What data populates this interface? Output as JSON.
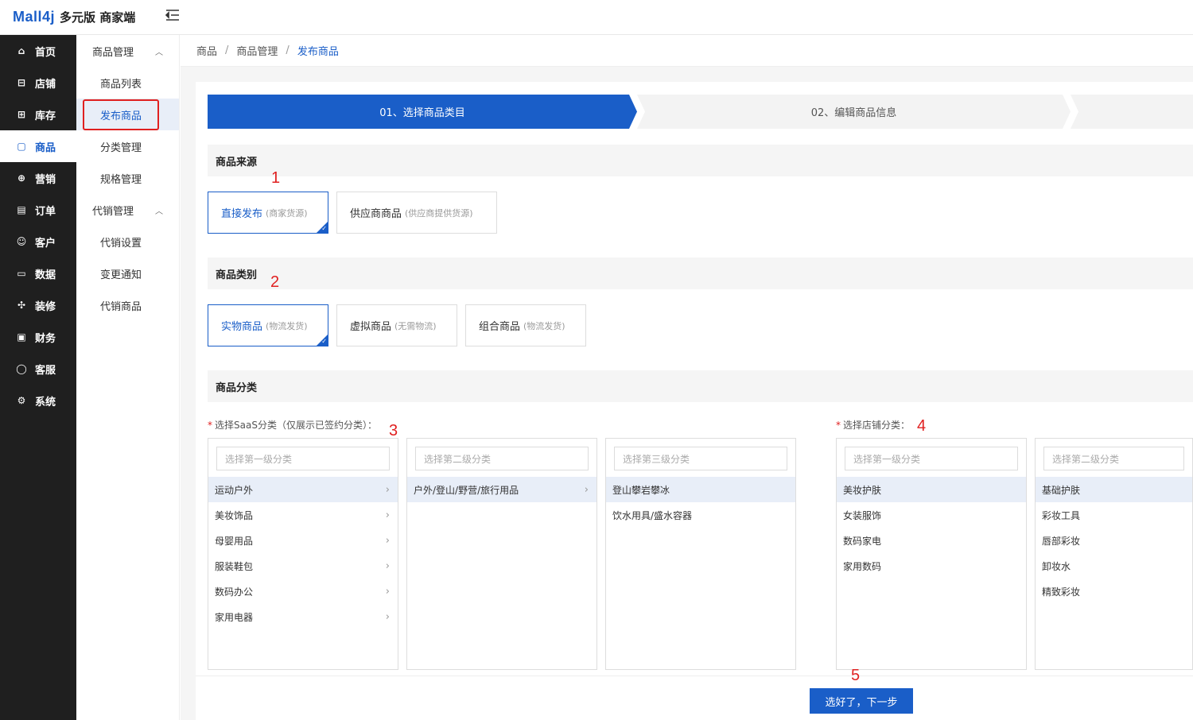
{
  "header": {
    "brand": "Mall4j",
    "subtitle": "多元版 商家端"
  },
  "leftnav": [
    {
      "label": "首页",
      "icon": "home-icon",
      "glyph": "⌂"
    },
    {
      "label": "店铺",
      "icon": "shop-icon",
      "glyph": "⊟"
    },
    {
      "label": "库存",
      "icon": "stock-icon",
      "glyph": "⊞"
    },
    {
      "label": "商品",
      "icon": "goods-icon",
      "glyph": "▢"
    },
    {
      "label": "营销",
      "icon": "gift-icon",
      "glyph": "⊕"
    },
    {
      "label": "订单",
      "icon": "order-icon",
      "glyph": "▤"
    },
    {
      "label": "客户",
      "icon": "customer-icon",
      "glyph": "☺"
    },
    {
      "label": "数据",
      "icon": "data-icon",
      "glyph": "▭"
    },
    {
      "label": "装修",
      "icon": "decorate-icon",
      "glyph": "✣"
    },
    {
      "label": "财务",
      "icon": "finance-icon",
      "glyph": "▣"
    },
    {
      "label": "客服",
      "icon": "service-icon",
      "glyph": "◯"
    },
    {
      "label": "系统",
      "icon": "settings-icon",
      "glyph": "⚙"
    }
  ],
  "subnav": {
    "group1": "商品管理",
    "items1": [
      "商品列表",
      "发布商品",
      "分类管理",
      "规格管理"
    ],
    "group2": "代销管理",
    "items2": [
      "代销设置",
      "变更通知",
      "代销商品"
    ]
  },
  "breadcrumb": [
    "商品",
    "商品管理",
    "发布商品"
  ],
  "steps": [
    "01、选择商品类目",
    "02、编辑商品信息"
  ],
  "sections": {
    "source": "商品来源",
    "type": "商品类别",
    "category": "商品分类"
  },
  "source_options": [
    {
      "label": "直接发布",
      "hint": "(商家货源)"
    },
    {
      "label": "供应商商品",
      "hint": "(供应商提供货源)"
    }
  ],
  "type_options": [
    {
      "label": "实物商品",
      "hint": "(物流发货)"
    },
    {
      "label": "虚拟商品",
      "hint": "(无需物流)"
    },
    {
      "label": "组合商品",
      "hint": "(物流发货)"
    }
  ],
  "saas_label": "选择SaaS分类（仅展示已签约分类）：",
  "shop_label": "选择店铺分类：",
  "panels": [
    {
      "placeholder": "选择第一级分类",
      "rows": [
        "运动户外",
        "美妆饰品",
        "母婴用品",
        "服装鞋包",
        "数码办公",
        "家用电器"
      ],
      "active": 0,
      "chevron": true
    },
    {
      "placeholder": "选择第二级分类",
      "rows": [
        "户外/登山/野营/旅行用品"
      ],
      "active": 0,
      "chevron": true
    },
    {
      "placeholder": "选择第三级分类",
      "rows": [
        "登山攀岩攀冰",
        "饮水用具/盛水容器"
      ],
      "active": 0,
      "chevron": false
    },
    {
      "placeholder": "选择第一级分类",
      "rows": [
        "美妆护肤",
        "女装服饰",
        "数码家电",
        "家用数码"
      ],
      "active": 0,
      "chevron": false
    },
    {
      "placeholder": "选择第二级分类",
      "rows": [
        "基础护肤",
        "彩妆工具",
        "唇部彩妆",
        "卸妆水",
        "精致彩妆"
      ],
      "active": 0,
      "chevron": false
    }
  ],
  "annotations": [
    "1",
    "2",
    "3",
    "4",
    "5"
  ],
  "next_button": "选好了，下一步",
  "colors": {
    "primary": "#1a5ec8",
    "annotation": "#e02020",
    "sidebar": "#1f1f1f"
  }
}
